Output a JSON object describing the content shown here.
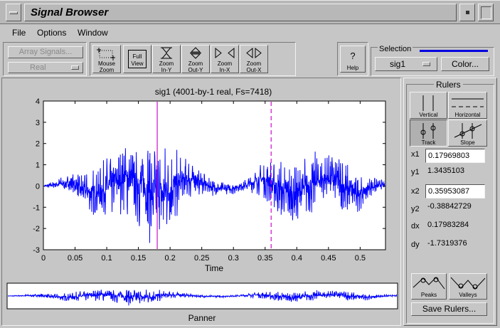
{
  "window": {
    "title": "Signal Browser"
  },
  "menu": [
    "File",
    "Options",
    "Window"
  ],
  "toolbar": {
    "array_signals_label": "Array Signals...",
    "real_dropdown": "Real",
    "mouse_zoom": [
      "Mouse",
      "Zoom"
    ],
    "full_view": [
      "Full",
      "View"
    ],
    "zoom_in_y": [
      "Zoom",
      "In-Y"
    ],
    "zoom_out_y": [
      "Zoom",
      "Out-Y"
    ],
    "zoom_in_x": [
      "Zoom",
      "In-X"
    ],
    "zoom_out_x": [
      "Zoom",
      "Out-X"
    ],
    "help": "Help",
    "selection_label": "Selection",
    "selection_color": "#0000e0",
    "signal_dropdown": "sig1",
    "color_button": "Color..."
  },
  "chart_data": {
    "type": "line",
    "title": "sig1 (4001-by-1 real, Fs=7418)",
    "xlabel": "Time",
    "ylabel": "",
    "xlim": [
      0,
      0.54
    ],
    "ylim": [
      -3,
      4
    ],
    "x_ticks": [
      "0",
      "0.05",
      "0.1",
      "0.15",
      "0.2",
      "0.25",
      "0.3",
      "0.35",
      "0.4",
      "0.45",
      "0.5"
    ],
    "y_ticks": [
      "4",
      "3",
      "2",
      "1",
      "0",
      "-1",
      "-2",
      "-3"
    ],
    "series": [
      {
        "color": "#0000ff",
        "envelope": [
          {
            "t": 0.0,
            "a": 0.05
          },
          {
            "t": 0.02,
            "a": 0.25
          },
          {
            "t": 0.04,
            "a": 0.45
          },
          {
            "t": 0.06,
            "a": 0.9
          },
          {
            "t": 0.08,
            "a": 1.2
          },
          {
            "t": 0.1,
            "a": 1.5
          },
          {
            "t": 0.12,
            "a": 1.6
          },
          {
            "t": 0.14,
            "a": 2.0
          },
          {
            "t": 0.16,
            "a": 2.4
          },
          {
            "t": 0.175,
            "a": 2.8
          },
          {
            "t": 0.19,
            "a": 2.6
          },
          {
            "t": 0.2,
            "a": 2.2
          },
          {
            "t": 0.22,
            "a": 1.3
          },
          {
            "t": 0.24,
            "a": 0.8
          },
          {
            "t": 0.26,
            "a": 0.45
          },
          {
            "t": 0.28,
            "a": 0.4
          },
          {
            "t": 0.3,
            "a": 0.35
          },
          {
            "t": 0.31,
            "a": 0.2
          },
          {
            "t": 0.33,
            "a": 0.5
          },
          {
            "t": 0.35,
            "a": 1.0
          },
          {
            "t": 0.37,
            "a": 1.4
          },
          {
            "t": 0.39,
            "a": 1.6
          },
          {
            "t": 0.41,
            "a": 1.6
          },
          {
            "t": 0.43,
            "a": 1.5
          },
          {
            "t": 0.45,
            "a": 1.2
          },
          {
            "t": 0.47,
            "a": 1.6
          },
          {
            "t": 0.49,
            "a": 1.1
          },
          {
            "t": 0.51,
            "a": 0.6
          },
          {
            "t": 0.53,
            "a": 0.3
          },
          {
            "t": 0.54,
            "a": 0.2
          }
        ]
      }
    ],
    "rulers": {
      "x1": 0.17969803,
      "x2": 0.35953087
    },
    "panner_label": "Panner"
  },
  "rulers_panel": {
    "title": "Rulers",
    "vertical": "Vertical",
    "horizontal": "Horizontal",
    "track": "Track",
    "slope": "Slope",
    "x1_label": "x1",
    "x1": "0.17969803",
    "y1_label": "y1",
    "y1": "1.3435103",
    "x2_label": "x2",
    "x2": "0.35953087",
    "y2_label": "y2",
    "y2": "-0.38842729",
    "dx_label": "dx",
    "dx": "0.17983284",
    "dy_label": "dy",
    "dy": "-1.7319376",
    "peaks": "Peaks",
    "valleys": "Valleys",
    "save": "Save Rulers..."
  }
}
